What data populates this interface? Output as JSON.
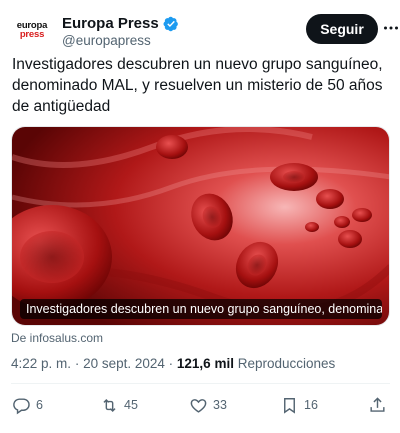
{
  "account": {
    "avatar_line1": "europa",
    "avatar_line2": "press",
    "name": "Europa Press",
    "handle": "@europapress",
    "follow_label": "Seguir"
  },
  "tweet": {
    "text": "Investigadores descubren un nuevo grupo sanguíneo, denominado MAL, y resuelven un misterio de 50 años de antigüedad",
    "card_title": "Investigadores descubren un nuevo grupo sanguíneo, denominado ...",
    "card_source": "De infosalus.com",
    "time": "4:22 p. m.",
    "date": "20 sept. 2024",
    "views_count": "121,6 mil",
    "views_label": "Reproducciones"
  },
  "actions": {
    "replies": "6",
    "retweets": "45",
    "likes": "33",
    "bookmarks": "16"
  },
  "icons": {
    "verified": "verified-badge-icon",
    "more": "more-dots-icon",
    "reply": "reply-icon",
    "retweet": "retweet-icon",
    "like": "heart-icon",
    "bookmark": "bookmark-icon",
    "share": "share-icon"
  },
  "colors": {
    "verified_blue": "#1d9bf0",
    "brand_red": "#d81e1e",
    "text_primary": "#0f1419",
    "text_secondary": "#536471"
  }
}
